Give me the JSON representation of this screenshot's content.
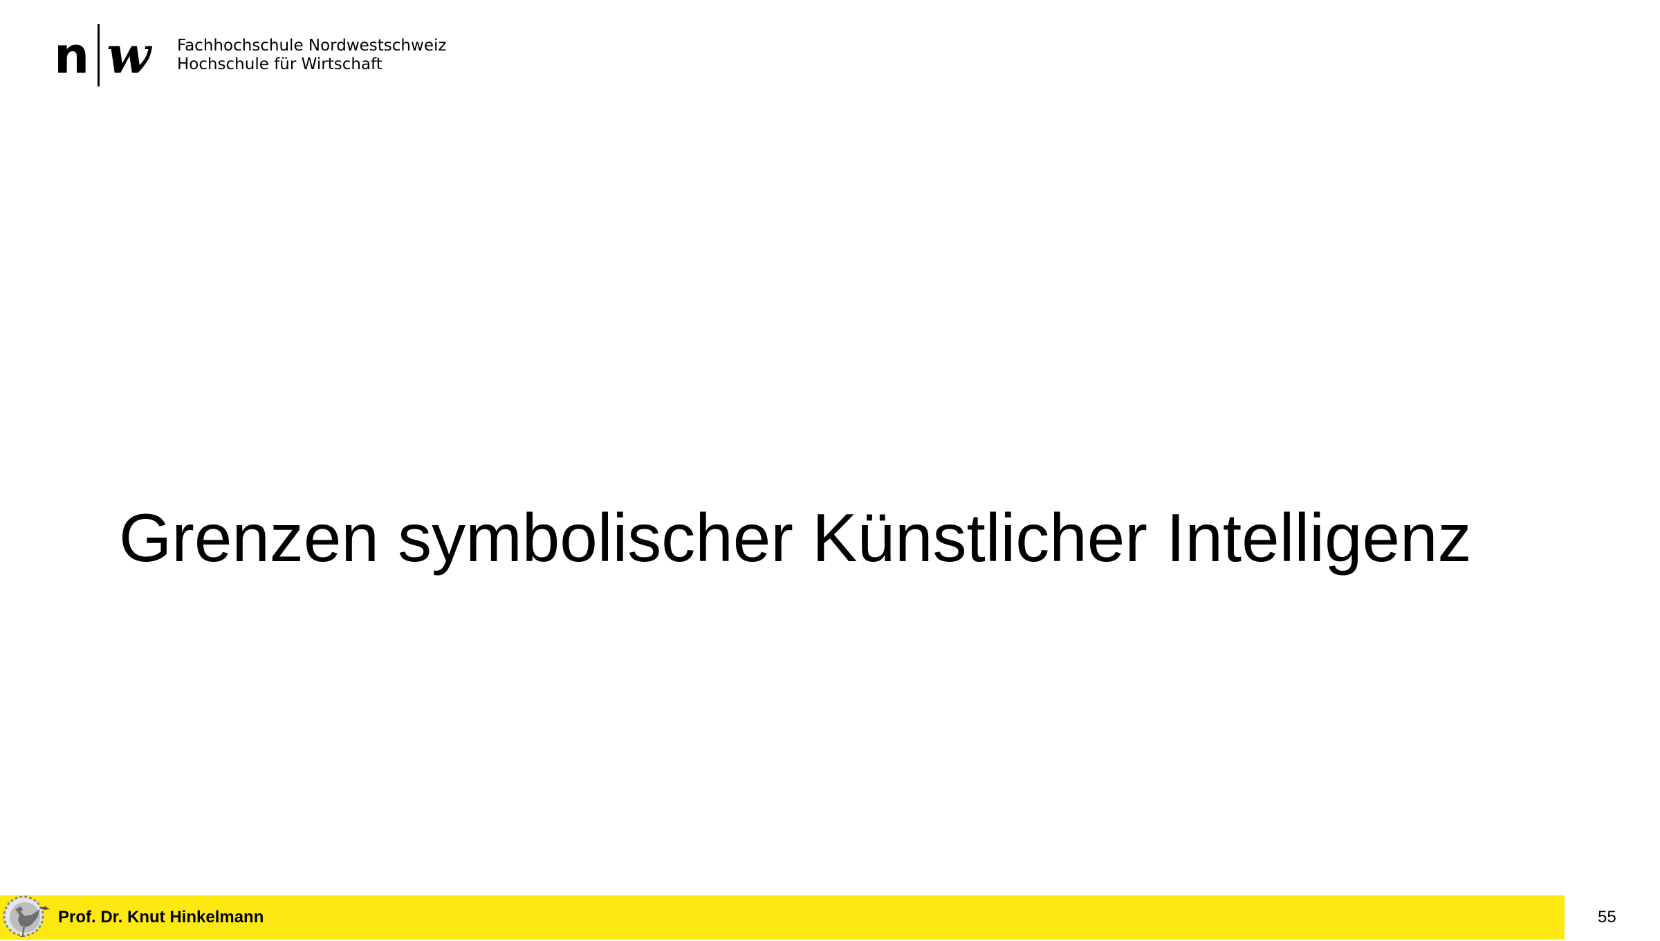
{
  "header": {
    "logo_letter_n": "n",
    "logo_letter_w": "w",
    "institution_line1": "Fachhochschule Nordwestschweiz",
    "institution_line2": "Hochschule für Wirtschaft"
  },
  "slide": {
    "title": "Grenzen symbolischer Künstlicher Intelligenz"
  },
  "footer": {
    "author": "Prof. Dr. Knut Hinkelmann",
    "page_number": "55",
    "bar_color": "#fde811",
    "emblem_icon": "rooster-gear-icon"
  }
}
